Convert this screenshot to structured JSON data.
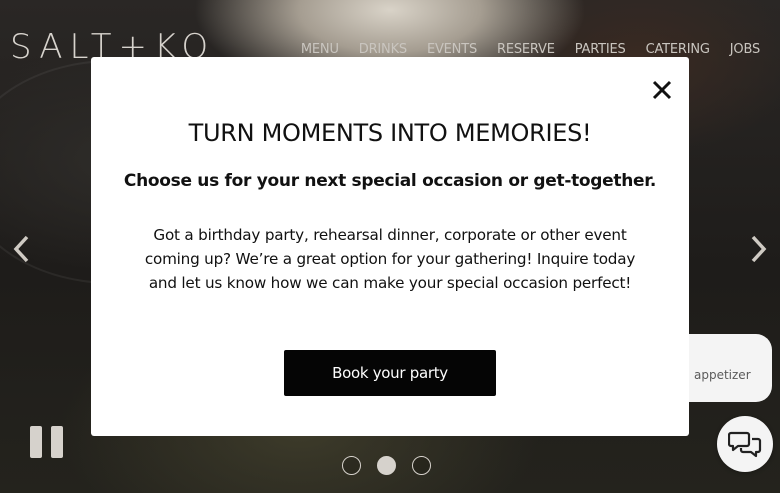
{
  "header": {
    "logo_text": "SALT+KO",
    "nav": [
      {
        "label": "MENU"
      },
      {
        "label": "DRINKS"
      },
      {
        "label": "EVENTS"
      },
      {
        "label": "RESERVE"
      },
      {
        "label": "PARTIES"
      },
      {
        "label": "CATERING"
      },
      {
        "label": "JOBS"
      }
    ]
  },
  "carousel": {
    "prev_icon": "chevron-left-icon",
    "next_icon": "chevron-right-icon",
    "pause_icon": "pause-icon",
    "slide_count": 3,
    "active_slide": 2
  },
  "chat": {
    "bubble_text": "appetizer",
    "button_icon": "chat-icon"
  },
  "modal": {
    "close_icon": "close-icon",
    "title": "TURN MOMENTS INTO MEMORIES!",
    "subtitle": "Choose us for your next special occasion or get-together.",
    "body": "Got a birthday party, rehearsal dinner, corporate or other event coming up? We’re a great option for your gathering! Inquire today and let us know how we can make your special occasion perfect!",
    "cta_label": "Book your party"
  },
  "colors": {
    "modal_bg": "#ffffff",
    "button_bg": "#050505",
    "nav_text": "#c9c5bf"
  }
}
